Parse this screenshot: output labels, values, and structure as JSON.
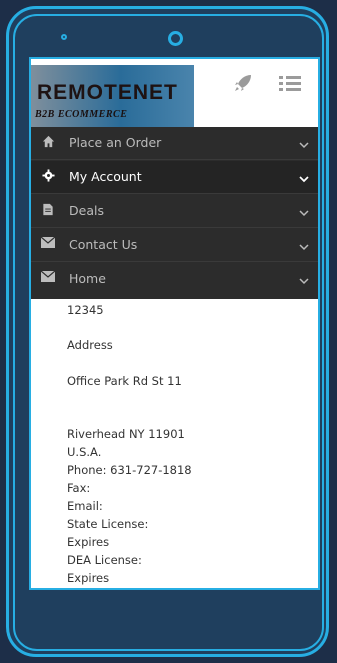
{
  "logo": {
    "title": "REMOTENET",
    "subtitle": "B2B ECOMMERCE"
  },
  "icons": {
    "rocket": "rocket-icon",
    "menu": "hamburger-menu-icon"
  },
  "nav": {
    "items": [
      {
        "label": "Place an Order",
        "icon": "home-icon"
      },
      {
        "label": "My Account",
        "icon": "gear-icon"
      },
      {
        "label": "Deals",
        "icon": "document-icon"
      },
      {
        "label": "Contact Us",
        "icon": "envelope-icon"
      },
      {
        "label": "Home",
        "icon": "envelope-icon"
      }
    ],
    "active_index": 1
  },
  "info": {
    "zip": "12345",
    "address_label": "Address",
    "street": "Office Park Rd St 11",
    "city": "Riverhead NY 11901",
    "country": "U.S.A.",
    "phone": "Phone: 631-727-1818",
    "fax": "Fax:",
    "email": "Email:",
    "state_license": "State License:",
    "expires1": "Expires",
    "dea_license": "DEA License:",
    "expires2": "Expires"
  },
  "colors": {
    "frame": "#27aee3",
    "background": "#1d2e48",
    "nav_bg": "#2c2c2c"
  }
}
